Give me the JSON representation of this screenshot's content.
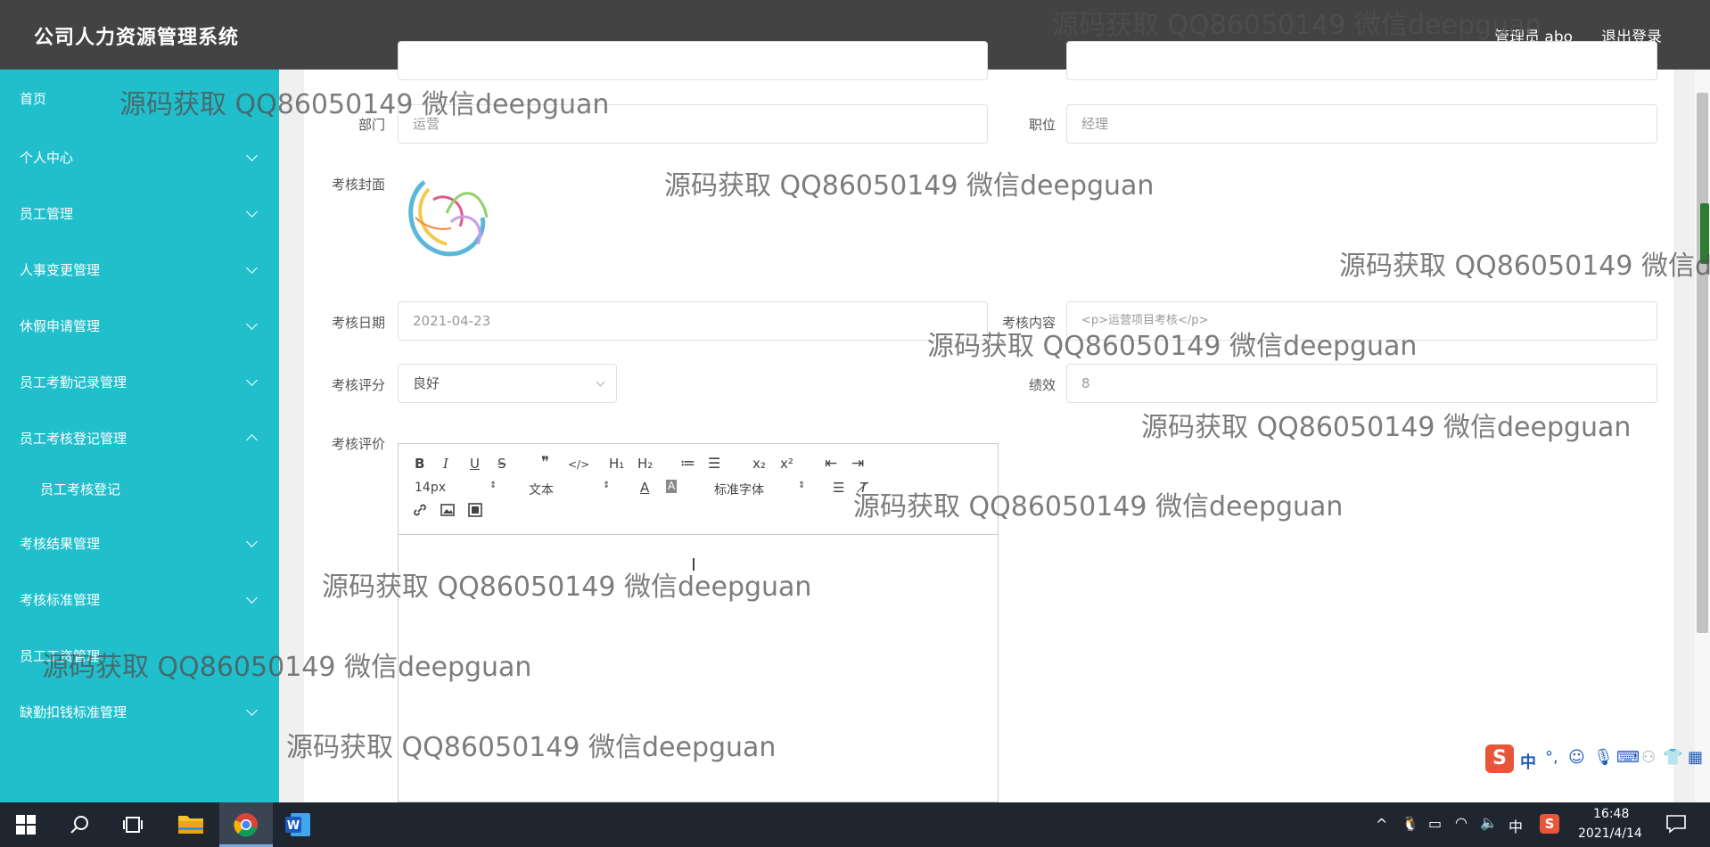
{
  "header": {
    "app_title": "公司人力资源管理系统",
    "user_label": "管理员 abo",
    "logout_label": "退出登录"
  },
  "sidebar": {
    "items": [
      {
        "label": "首页",
        "expandable": false
      },
      {
        "label": "个人中心",
        "expandable": true
      },
      {
        "label": "员工管理",
        "expandable": true
      },
      {
        "label": "人事变更管理",
        "expandable": true
      },
      {
        "label": "休假申请管理",
        "expandable": true
      },
      {
        "label": "员工考勤记录管理",
        "expandable": true
      },
      {
        "label": "员工考核登记管理",
        "expandable": true,
        "expanded": true
      },
      {
        "label": "员工考核登记",
        "sub": true
      },
      {
        "label": "考核结果管理",
        "expandable": true
      },
      {
        "label": "考核标准管理",
        "expandable": true
      },
      {
        "label": "员工工资管理",
        "expandable": true
      },
      {
        "label": "缺勤扣钱标准管理",
        "expandable": true
      }
    ]
  },
  "form": {
    "department": {
      "label": "部门",
      "value": "运营"
    },
    "position": {
      "label": "职位",
      "value": "经理"
    },
    "cover": {
      "label": "考核封面"
    },
    "date": {
      "label": "考核日期",
      "value": "2021-04-23"
    },
    "content": {
      "label": "考核内容",
      "value": "<p>运营项目考核</p>"
    },
    "rating": {
      "label": "考核评分",
      "value": "良好"
    },
    "performance": {
      "label": "绩效",
      "value": "8"
    },
    "comment": {
      "label": "考核评价"
    }
  },
  "editor": {
    "toolbar": {
      "font_size": "14px",
      "text_style": "文本",
      "font_family": "标准字体",
      "bold": "B",
      "italic": "I",
      "underline": "U",
      "strike": "S",
      "quote": "❞",
      "code": "</>",
      "h1": "H₁",
      "h2": "H₂",
      "ol": "≔",
      "ul": "☰",
      "sub": "x₂",
      "sup": "x²",
      "outdent": "⇤",
      "indent": "⇥",
      "color": "A",
      "bg": "A",
      "align": "☰",
      "clear": "T̸"
    }
  },
  "watermark": {
    "text": "源码获取 QQ86050149 微信deepguan",
    "cut_text": "源码获取 QQ86050149 微信d"
  },
  "taskbar": {
    "time": "16:48",
    "date": "2021/4/14",
    "ime_lang": "中"
  },
  "ime": {
    "lang": "中"
  },
  "colors": {
    "topbar": "#434343",
    "sidebar": "#21bfcc",
    "taskbar": "#1f2630"
  }
}
